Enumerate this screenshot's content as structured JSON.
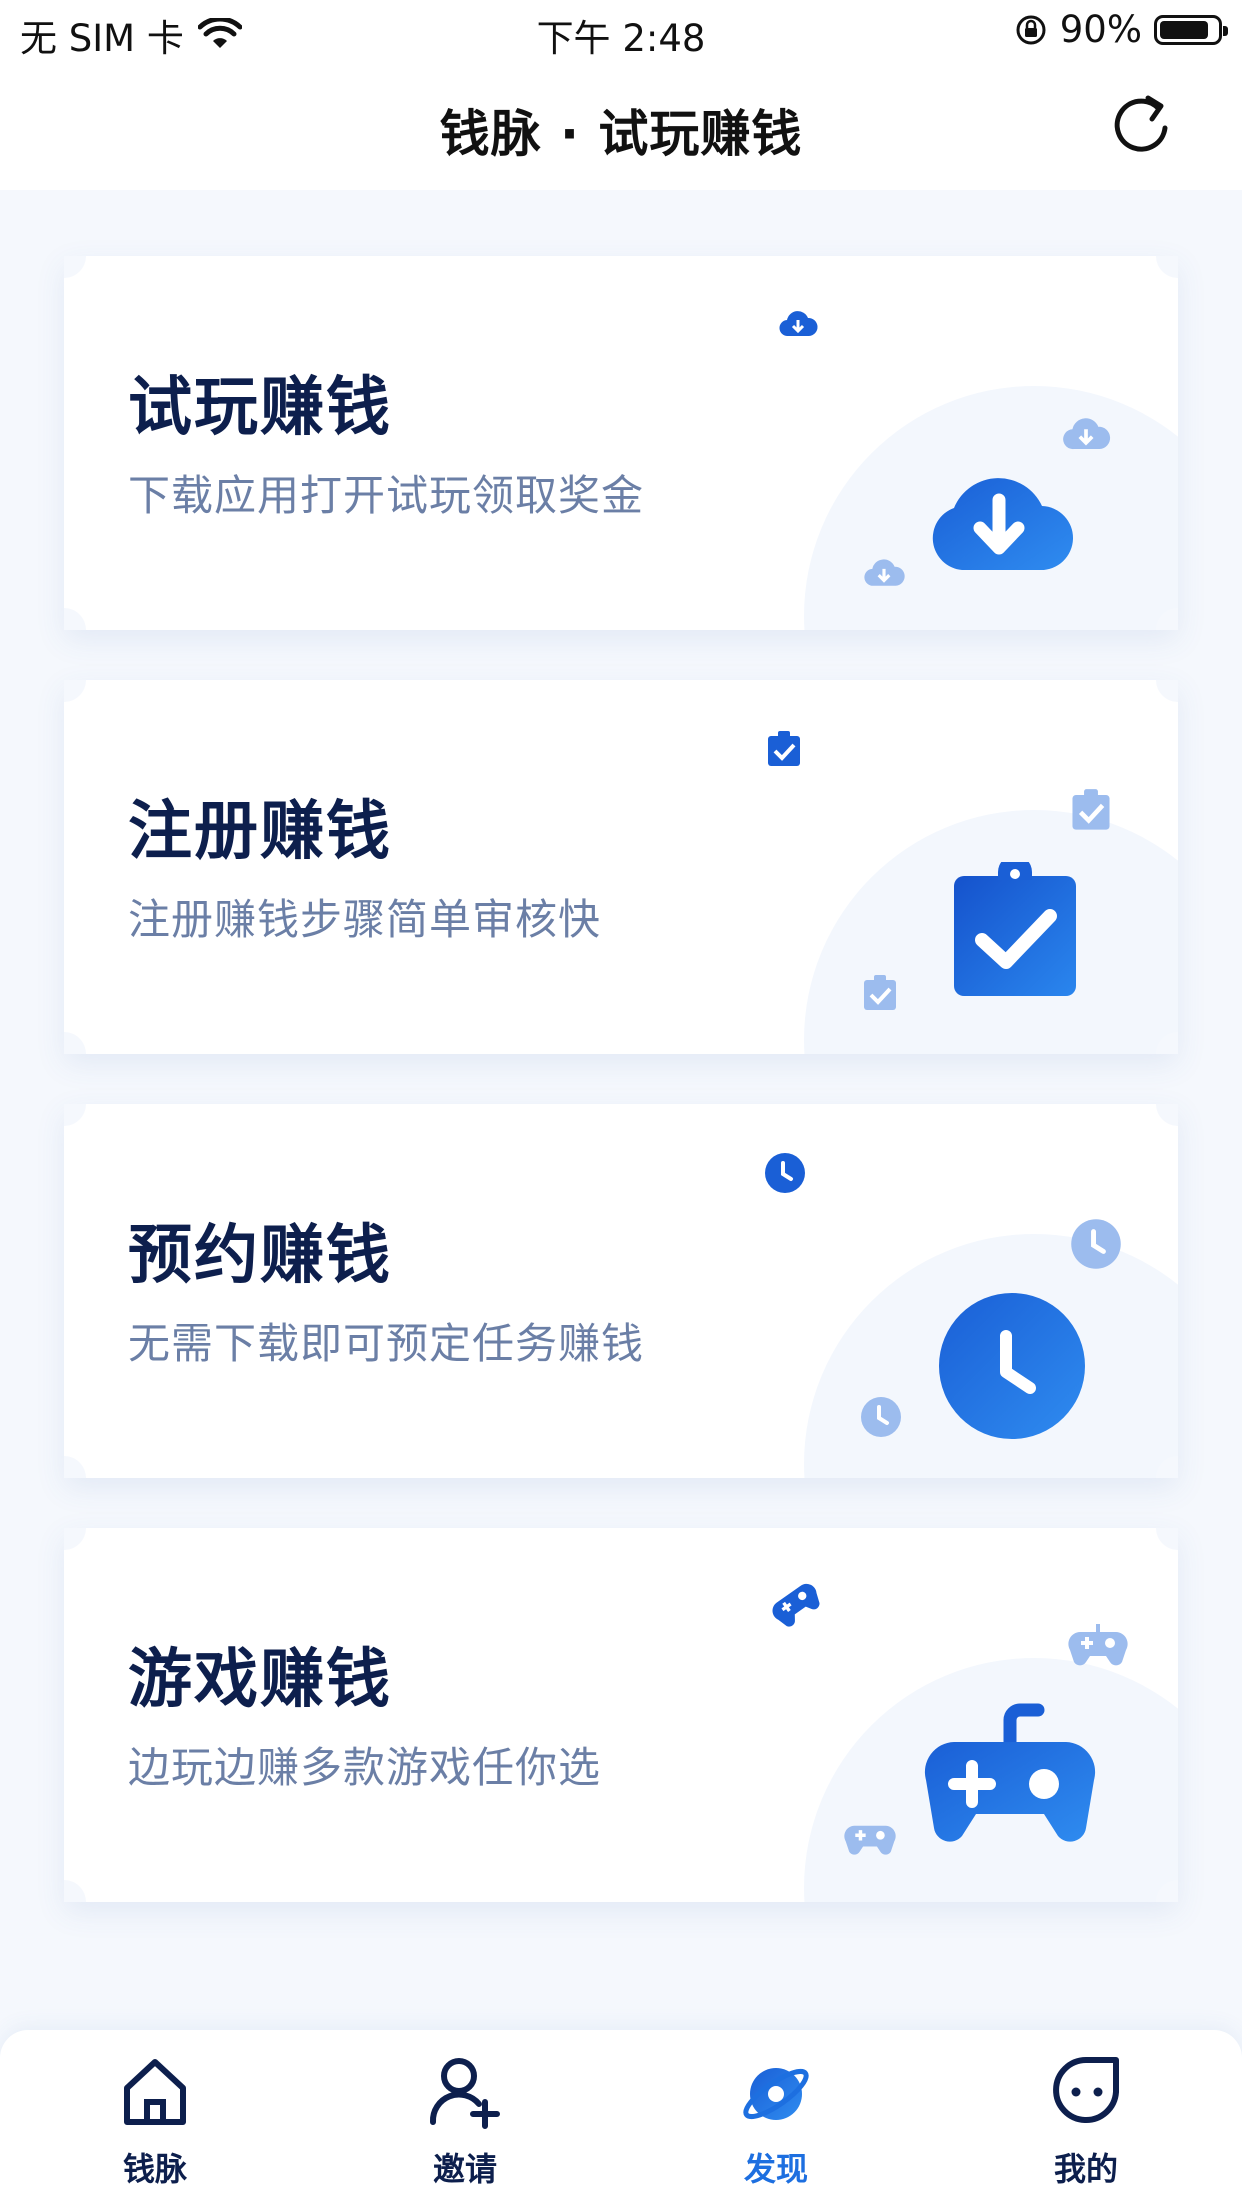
{
  "status_bar": {
    "carrier": "无 SIM 卡",
    "time": "下午 2:48",
    "battery": "90%",
    "battery_level": 0.9
  },
  "nav": {
    "title": "钱脉 · 试玩赚钱",
    "refresh_icon": "refresh-icon"
  },
  "cards": [
    {
      "title": "试玩赚钱",
      "subtitle": "下载应用打开试玩领取奖金",
      "icon": "cloud-download-icon"
    },
    {
      "title": "注册赚钱",
      "subtitle": "注册赚钱步骤简单审核快",
      "icon": "clipboard-check-icon"
    },
    {
      "title": "预约赚钱",
      "subtitle": "无需下载即可预定任务赚钱",
      "icon": "clock-icon"
    },
    {
      "title": "游戏赚钱",
      "subtitle": "边玩边赚多款游戏任你选",
      "icon": "gamepad-icon"
    }
  ],
  "tabs": [
    {
      "label": "钱脉",
      "icon": "home-icon",
      "active": false
    },
    {
      "label": "邀请",
      "icon": "add-user-icon",
      "active": false
    },
    {
      "label": "发现",
      "icon": "discover-planet-icon",
      "active": true
    },
    {
      "label": "我的",
      "icon": "profile-face-icon",
      "active": false
    }
  ],
  "colors": {
    "accent": "#1d6fe0",
    "title": "#0d1f4d",
    "subtitle": "#6b7fa6",
    "background": "#f5f8fd"
  }
}
